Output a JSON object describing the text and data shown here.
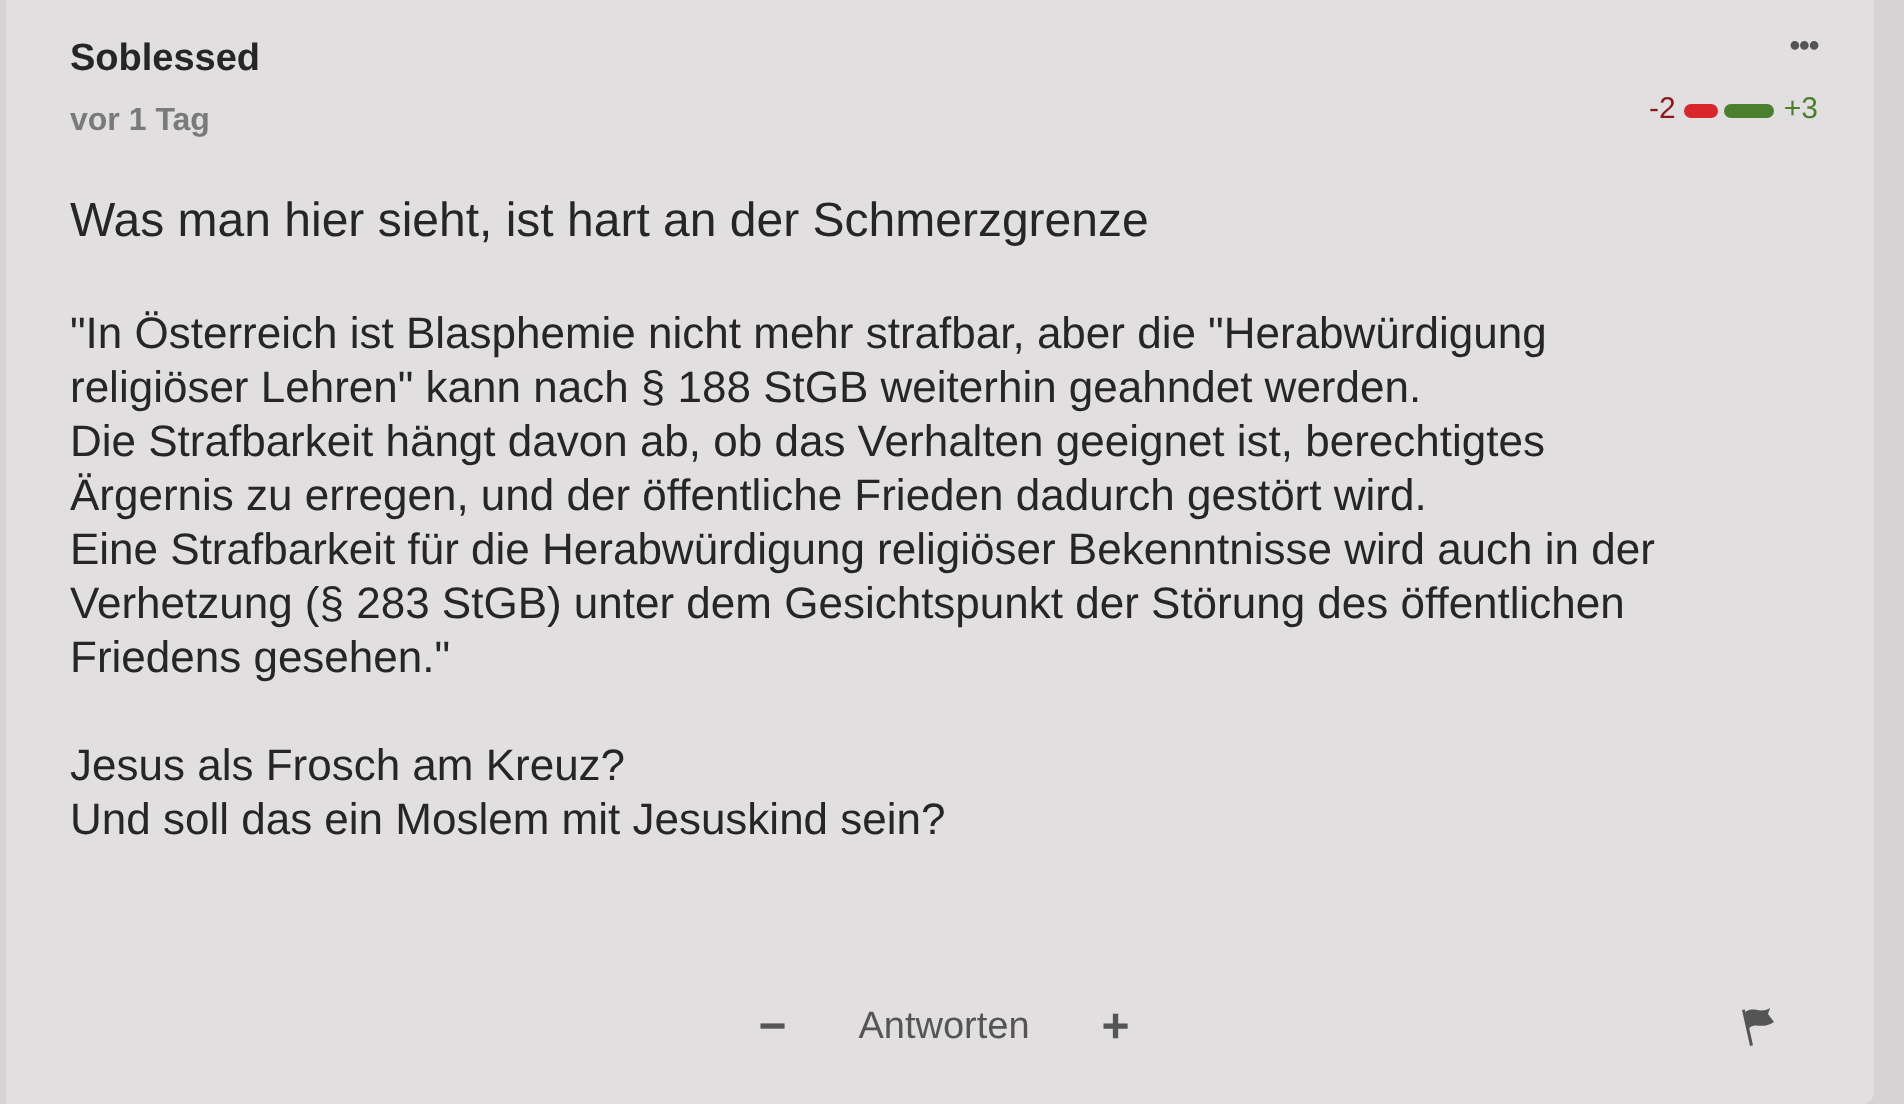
{
  "comment": {
    "author": "Soblessed",
    "time": "vor 1 Tag",
    "menu": "•••",
    "votes": {
      "down": "-2",
      "up": "+3"
    },
    "title": "Was man hier sieht, ist hart an der Schmerzgrenze",
    "paragraphs": [
      {
        "lines": [
          "\"In Österreich ist Blasphemie nicht mehr strafbar, aber die \"Herabwürdigung",
          "religiöser Lehren\" kann nach § 188 StGB weiterhin geahndet werden.",
          "Die Strafbarkeit hängt davon ab, ob das Verhalten geeignet ist, berechtigtes",
          "Ärgernis zu erregen, und der öffentliche Frieden dadurch gestört wird.",
          "Eine Strafbarkeit für die Herabwürdigung religiöser Bekenntnisse wird auch in der",
          "Verhetzung (§ 283 StGB) unter dem Gesichtspunkt der Störung des öffentlichen",
          "Friedens gesehen.\""
        ]
      },
      {
        "lines": [
          "Jesus als Frosch am Kreuz?",
          "Und soll das ein Moslem mit Jesuskind sein?"
        ]
      }
    ],
    "actions": {
      "minus": "−",
      "reply": "Antworten",
      "plus": "+"
    }
  }
}
